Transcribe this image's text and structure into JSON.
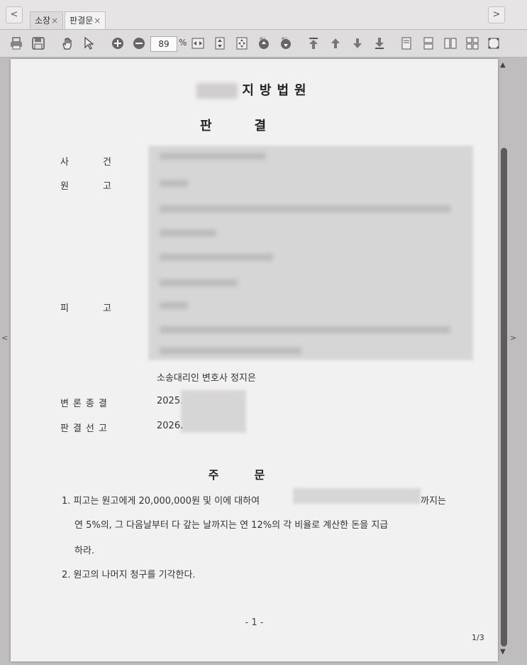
{
  "tabs": [
    {
      "label": "소장",
      "close": "×"
    },
    {
      "label": "판결문",
      "close": "×"
    }
  ],
  "nav": {
    "prev": "<",
    "next": ">"
  },
  "toolbar": {
    "zoom_value": "89",
    "zoom_unit": "%"
  },
  "document": {
    "court_suffix": "지방법원",
    "title": "판결",
    "fields": {
      "case_label": "사건",
      "plaintiff_label": "원고",
      "defendant_label": "피고",
      "counsel_text": "소송대리인 변호사 정지은",
      "closing_label": "변론종결",
      "closing_value": "2025.",
      "decision_label": "판결선고",
      "decision_value": "2026."
    },
    "ruling_title": "주문",
    "ruling_items": {
      "item1_line1_a": "1. 피고는 원고에게 20,000,000원 및 이에 대하여",
      "item1_line1_b": "까지는",
      "item1_line2": "연 5%의, 그 다음날부터 다 갚는 날까지는 연 12%의 각 비율로 계산한 돈을 지급",
      "item1_line3": "하라.",
      "item2": "2. 원고의 나머지 청구를 기각한다."
    },
    "page_number": "- 1 -",
    "page_count": "1/3"
  },
  "side_arrows": {
    "left": "<",
    "right": ">"
  }
}
